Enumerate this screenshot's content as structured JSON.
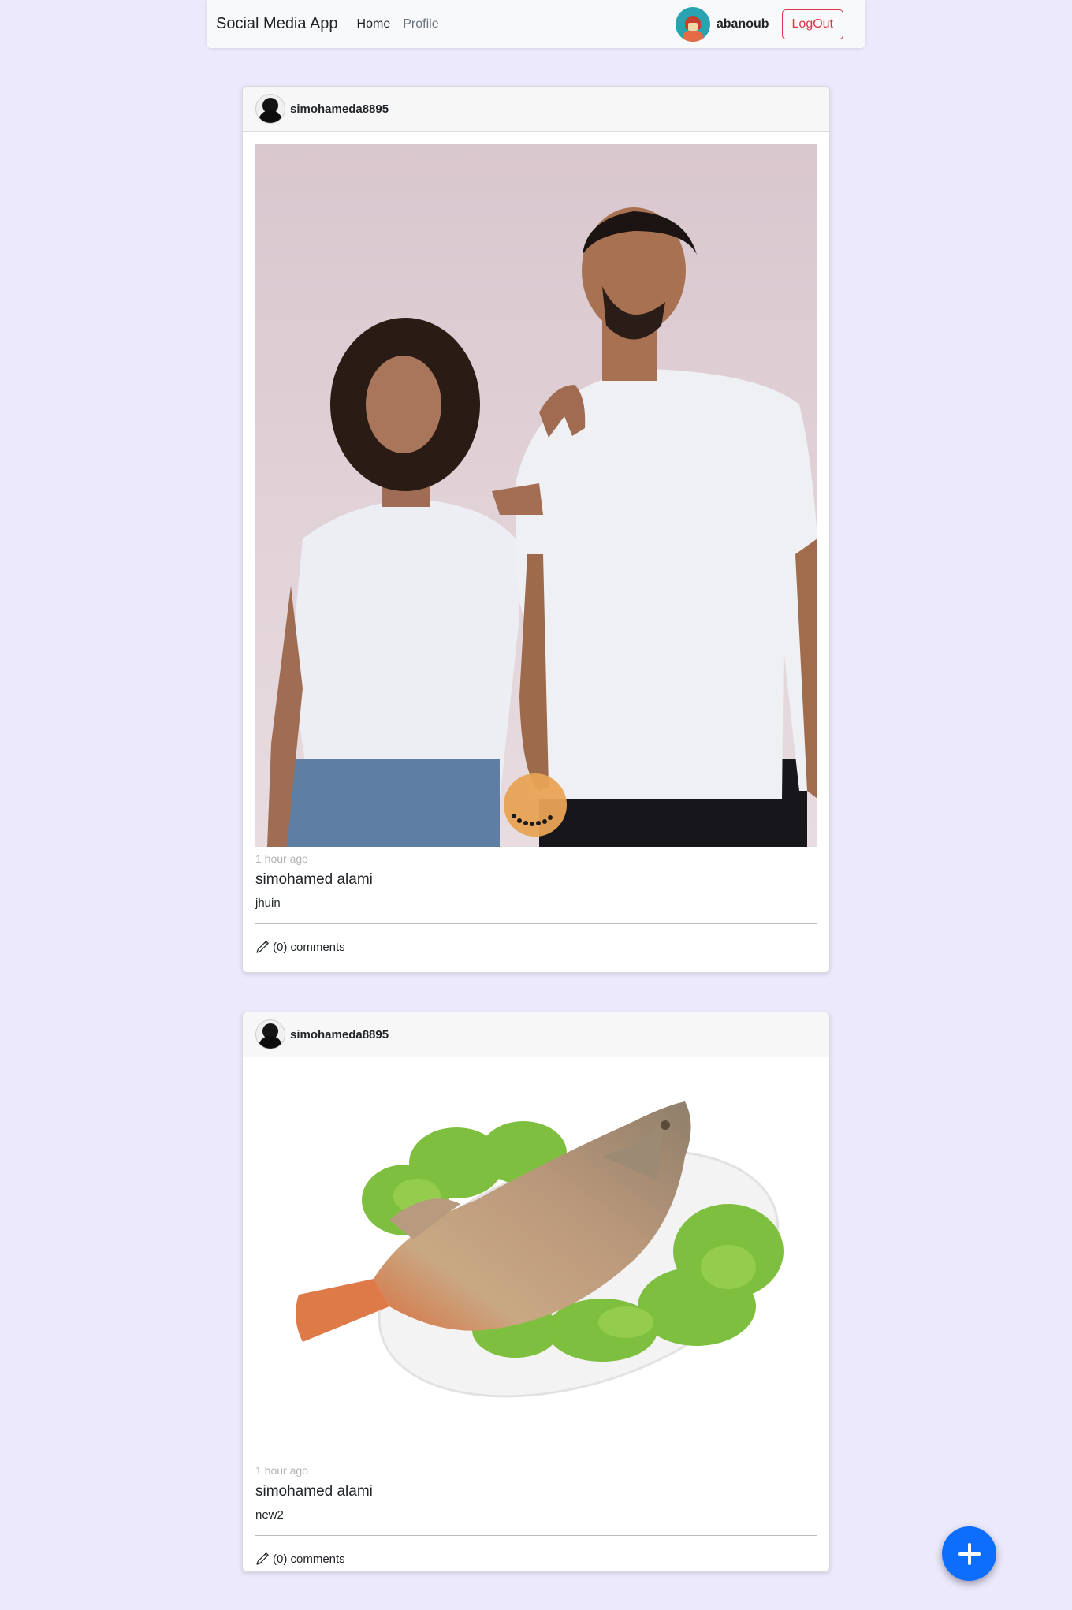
{
  "navbar": {
    "brand": "Social Media App",
    "links": [
      {
        "label": "Home",
        "active": true
      },
      {
        "label": "Profile",
        "active": false
      }
    ],
    "username": "abanoub",
    "avatar_icon": "user-avatar-icon",
    "logout_label": "LogOut"
  },
  "posts": [
    {
      "author": "simohameda8895",
      "image_desc": "photo",
      "time": "1 hour ago",
      "title": "simohamed alami",
      "body": "jhuin",
      "comments": "(0) comments"
    },
    {
      "author": "simohameda8895",
      "image_desc": "photo",
      "time": "1 hour ago",
      "title": "simohamed alami",
      "body": "new2",
      "comments": "(0) comments"
    }
  ],
  "fab": {
    "icon": "plus-icon"
  },
  "colors": {
    "background": "#ece9fd",
    "accent": "#0d6efd",
    "danger": "#dc3545"
  }
}
